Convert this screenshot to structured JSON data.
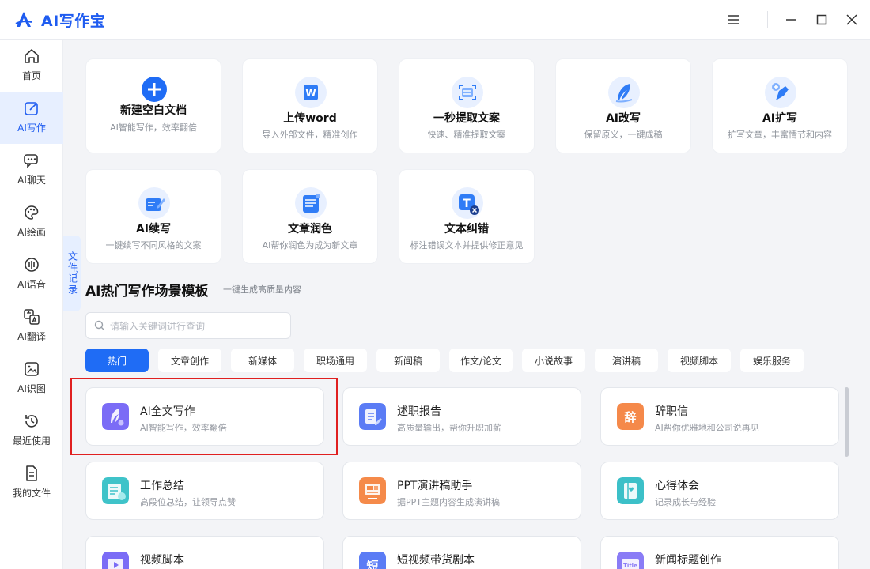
{
  "app": {
    "title": "AI写作宝",
    "brand_color": "#1f5cf0"
  },
  "titlebar": {
    "menu_icon": "menu-icon",
    "minimize_icon": "minimize-icon",
    "maximize_icon": "maximize-icon",
    "close_icon": "close-icon"
  },
  "sidebar": {
    "items": [
      {
        "label": "首页",
        "icon": "home-icon",
        "active": false
      },
      {
        "label": "AI写作",
        "icon": "edit-icon",
        "active": true
      },
      {
        "label": "AI聊天",
        "icon": "chat-icon",
        "active": false
      },
      {
        "label": "AI绘画",
        "icon": "palette-icon",
        "active": false
      },
      {
        "label": "AI语音",
        "icon": "voice-icon",
        "active": false
      },
      {
        "label": "AI翻译",
        "icon": "translate-icon",
        "active": false
      },
      {
        "label": "AI识图",
        "icon": "image-icon",
        "active": false
      },
      {
        "label": "最近使用",
        "icon": "history-icon",
        "active": false
      },
      {
        "label": "我的文件",
        "icon": "file-icon",
        "active": false
      }
    ]
  },
  "file_records_tab": {
    "label": "文件记录"
  },
  "features": [
    {
      "title": "新建空白文档",
      "desc": "AI智能写作，效率翻倍",
      "icon": "plus-icon"
    },
    {
      "title": "上传word",
      "desc": "导入外部文件，精准创作",
      "icon": "word-icon"
    },
    {
      "title": "一秒提取文案",
      "desc": "快速、精准提取文案",
      "icon": "scan-text-icon"
    },
    {
      "title": "AI改写",
      "desc": "保留原义，一键成稿",
      "icon": "feather-icon"
    },
    {
      "title": "AI扩写",
      "desc": "扩写文章，丰富情节和内容",
      "icon": "expand-pen-icon"
    },
    {
      "title": "AI续写",
      "desc": "一键续写不同风格的文案",
      "icon": "continue-write-icon"
    },
    {
      "title": "文章润色",
      "desc": "AI帮你润色为成为新文章",
      "icon": "polish-icon"
    },
    {
      "title": "文本纠错",
      "desc": "标注错误文本并提供修正意见",
      "icon": "text-correct-icon"
    }
  ],
  "templates_section": {
    "title": "AI热门写作场景模板",
    "subtitle": "一键生成高质量内容",
    "search_placeholder": "请输入关键词进行查询",
    "categories": [
      "热门",
      "文章创作",
      "新媒体",
      "职场通用",
      "新闻稿",
      "作文/论文",
      "小说故事",
      "演讲稿",
      "视频脚本",
      "娱乐服务"
    ],
    "active_category": "热门",
    "templates": [
      {
        "title": "AI全文写作",
        "desc": "AI智能写作，效率翻倍",
        "icon": "ai-fullwrite-icon",
        "color": "#7b6cf6"
      },
      {
        "title": "述职报告",
        "desc": "高质量输出，帮你升职加薪",
        "icon": "report-icon",
        "color": "#5b7cf5"
      },
      {
        "title": "辞职信",
        "desc": "AI帮你优雅地和公司说再见",
        "icon": "resign-letter-icon",
        "color": "#f5894a",
        "glyph": "辞"
      },
      {
        "title": "工作总结",
        "desc": "高段位总结，让领导点赞",
        "icon": "work-summary-icon",
        "color": "#3fc3c9"
      },
      {
        "title": "PPT演讲稿助手",
        "desc": "据PPT主题内容生成演讲稿",
        "icon": "ppt-icon",
        "color": "#f58a4a"
      },
      {
        "title": "心得体会",
        "desc": "记录成长与经验",
        "icon": "notebook-icon",
        "color": "#3cc0c8"
      },
      {
        "title": "视频脚本",
        "desc": "",
        "icon": "video-script-icon",
        "color": "#7b6cf6"
      },
      {
        "title": "短视频带货剧本",
        "desc": "",
        "icon": "short-video-icon",
        "color": "#5b7cf5",
        "glyph": "短"
      },
      {
        "title": "新闻标题创作",
        "desc": "",
        "icon": "news-title-icon",
        "color": "#8a7cf6",
        "glyph": "Title"
      }
    ]
  }
}
